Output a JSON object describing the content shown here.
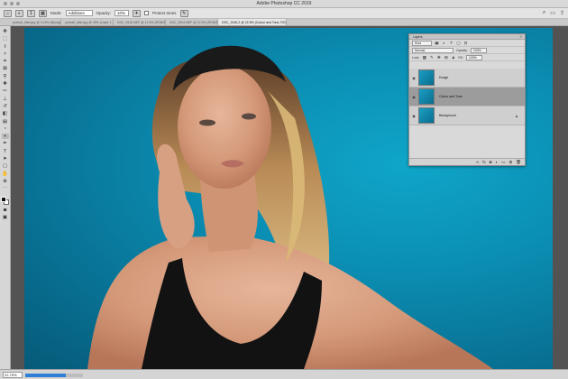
{
  "window": {
    "title": "Adobe Photoshop CC 2019"
  },
  "options_bar": {
    "brush_size": "1",
    "mode_label": "Mode:",
    "mode_value": "Additives",
    "opacity_label": "Opacity:",
    "opacity_value": "10%",
    "protect_tones_label": "Protect tones"
  },
  "tabs": [
    {
      "label": "portrait_after.jpg @ 13.6% (Background copy, RGB/8)"
    },
    {
      "label": "portrait_after.jpg @ 25% (Layer 1 copy 2, RGB/8)"
    },
    {
      "label": "DSC_0916.NEF @ 12.5% (RGB/8)"
    },
    {
      "label": "DSC_0924.NEF @ 12.5% (RGB/8)"
    },
    {
      "label": "DSC_1046-2 @ 22.8% (Colour and Tone, RGB/16)"
    }
  ],
  "toolbar": {
    "tools": [
      "move",
      "marquee",
      "lasso",
      "quick-select",
      "crop",
      "frame",
      "eyedropper",
      "healing",
      "brush",
      "stamp",
      "history-brush",
      "eraser",
      "gradient",
      "blur",
      "dodge",
      "pen",
      "type",
      "path-select",
      "shape",
      "hand",
      "zoom",
      "more"
    ]
  },
  "status": {
    "zoom": "22.79%",
    "progress": 0.7
  },
  "layers_panel": {
    "tab": "Layers",
    "kind_value": "Kind",
    "blend_mode": "Normal",
    "opacity_label": "Opacity:",
    "opacity_value": "100%",
    "lock_label": "Lock:",
    "fill_label": "Fill:",
    "fill_value": "100%",
    "layers": [
      {
        "name": "Dodge",
        "selected": false
      },
      {
        "name": "Colour and Tone",
        "selected": true
      },
      {
        "name": "Background",
        "selected": false,
        "locked": true
      }
    ]
  },
  "colors": {
    "backdrop": "#0b8fb4",
    "chrome": "#d9d9d9",
    "workspace": "#535353",
    "selected_layer": "#9c9c9c"
  }
}
